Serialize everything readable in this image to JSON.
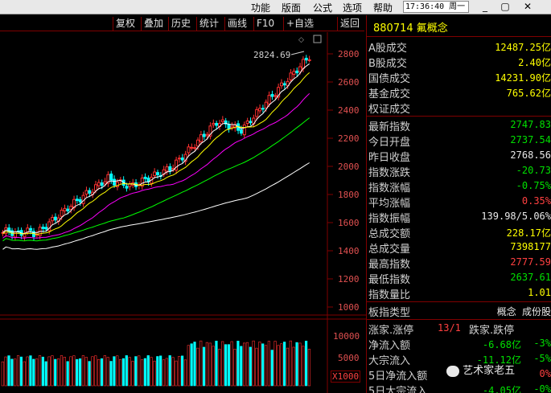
{
  "menu": {
    "items": [
      "功能",
      "版面",
      "公式",
      "选项",
      "帮助"
    ],
    "clock": "17:36:40 周一",
    "win_buttons": [
      "_",
      "▢",
      "✕"
    ]
  },
  "toolbar": {
    "buttons": [
      "复权",
      "叠加",
      "历史",
      "统计",
      "画线",
      "F10",
      "+自选",
      "返回"
    ]
  },
  "chart": {
    "annotation": "2824.69",
    "y_ticks": [
      "2800",
      "2600",
      "2400",
      "2200",
      "2000",
      "1800",
      "1600",
      "1400",
      "1200",
      "1000"
    ],
    "vol_ticks": [
      "10000",
      "5000"
    ],
    "vol_unit": "X1000",
    "colors": {
      "up": "#ff3030",
      "down": "#00ffff",
      "ma5": "#ffffff",
      "ma10": "#ffff00",
      "ma20": "#ff00ff",
      "ma60": "#00ff00",
      "ma120": "#ffffff"
    }
  },
  "panel": {
    "code": "880714",
    "name": "氟概念",
    "rows1": [
      {
        "label": "A股成交",
        "value": "12487.25亿",
        "color": "yellow"
      },
      {
        "label": "B股成交",
        "value": "2.40亿",
        "color": "yellow"
      },
      {
        "label": "国债成交",
        "value": "14231.90亿",
        "color": "yellow"
      },
      {
        "label": "基金成交",
        "value": "765.62亿",
        "color": "yellow"
      },
      {
        "label": "权证成交",
        "value": "",
        "color": "yellow"
      }
    ],
    "rows2": [
      {
        "label": "最新指数",
        "value": "2747.83",
        "color": "green"
      },
      {
        "label": "今日开盘",
        "value": "2737.54",
        "color": "green"
      },
      {
        "label": "昨日收盘",
        "value": "2768.56",
        "color": "white"
      },
      {
        "label": "指数涨跌",
        "value": "-20.73",
        "color": "green"
      },
      {
        "label": "指数涨幅",
        "value": "-0.75%",
        "color": "green"
      },
      {
        "label": "平均涨幅",
        "value": "0.35%",
        "color": "red"
      },
      {
        "label": "指数振幅",
        "value": "139.98/5.06%",
        "color": "white"
      },
      {
        "label": "总成交额",
        "value": "228.17亿",
        "color": "yellow"
      },
      {
        "label": "总成交量",
        "value": "7398177",
        "color": "yellow"
      },
      {
        "label": "最高指数",
        "value": "2777.59",
        "color": "red"
      },
      {
        "label": "最低指数",
        "value": "2637.61",
        "color": "green"
      },
      {
        "label": "指数量比",
        "value": "1.01",
        "color": "yellow"
      }
    ],
    "type_row": {
      "label": "板指类型",
      "value": "概念 成份股"
    },
    "rows3": [
      {
        "label": "涨家.涨停",
        "value": "13/1",
        "label2": "跌家.跌停",
        "color": "red"
      },
      {
        "label": "净流入额",
        "value": "-6.68亿",
        "pct": "-3%",
        "color": "green"
      },
      {
        "label": "大宗流入",
        "value": "-11.12亿",
        "pct": "-5%",
        "color": "green"
      },
      {
        "label": "5日净流入额",
        "value": "",
        "pct": "0%",
        "color": "red"
      },
      {
        "label": "5日大宗流入",
        "value": "-4.05亿",
        "pct": "-0%",
        "color": "green"
      }
    ]
  },
  "watermark": "艺术家老五"
}
